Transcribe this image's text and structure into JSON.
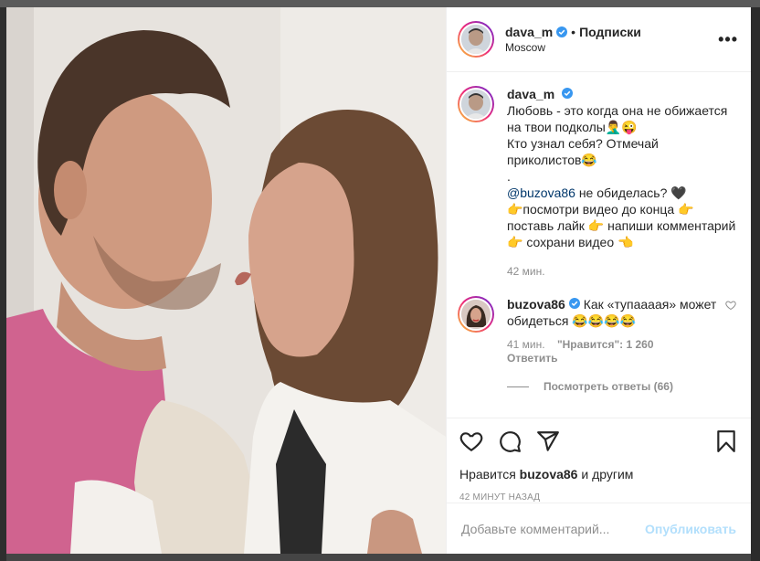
{
  "header": {
    "username": "dava_m",
    "separator": "•",
    "follow_label": "Подписки",
    "location": "Moscow",
    "more_label": "•••"
  },
  "caption": {
    "username": "dava_m",
    "text": "Любовь - это когда она не обижается на твои подколы🤦‍♂️😜\nКто узнал себя? Отмечай приколистов😂\n.",
    "mention": "@buzova86",
    "text2": " не обиделась? 🖤\n👉посмотри видео до конца 👉 поставь лайк 👉 напиши комментарий 👉 сохрани видео 👈",
    "time": "42 мин."
  },
  "comment": {
    "username": "buzova86",
    "text": " Как «тупаааая» может обидеться 😂😂😂😂",
    "time": "41 мин.",
    "likes_label": "\"Нравится\": 1 260",
    "reply_label": "Ответить",
    "view_replies": "Посмотреть ответы (66)"
  },
  "likes": {
    "prefix": "Нравится",
    "user": "buzova86",
    "suffix": "и другим"
  },
  "posted_ago": "42 МИНУТ НАЗАД",
  "add_comment": {
    "placeholder": "Добавьте комментарий...",
    "publish_label": "Опубликовать"
  },
  "icons": {
    "like": "heart-icon",
    "comment": "comment-icon",
    "share": "share-icon",
    "save": "bookmark-icon",
    "verified": "verified-badge-icon",
    "small_like": "heart-icon"
  },
  "colors": {
    "verified": "#3897f0",
    "link": "#00376b",
    "muted": "#8e8e8e",
    "publish_disabled": "#b2dffc"
  }
}
